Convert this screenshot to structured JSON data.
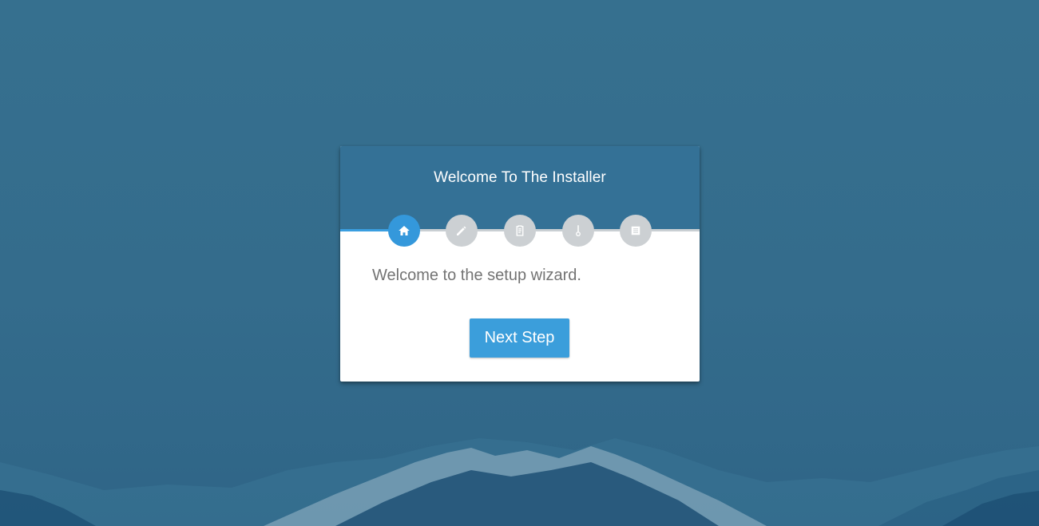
{
  "colors": {
    "background": "#346b8c",
    "header": "#347196",
    "accent": "#3498db",
    "inactive_step": "#ccd0d3",
    "body_text": "#737373"
  },
  "installer": {
    "title": "Welcome To The Installer",
    "progress": 0.17,
    "steps": [
      {
        "icon": "home-icon",
        "active": true
      },
      {
        "icon": "pencil-icon",
        "active": false
      },
      {
        "icon": "clipboard-icon",
        "active": false
      },
      {
        "icon": "thermometer-icon",
        "active": false
      },
      {
        "icon": "list-icon",
        "active": false
      }
    ],
    "message": "Welcome to the setup wizard.",
    "next_button": "Next Step"
  }
}
